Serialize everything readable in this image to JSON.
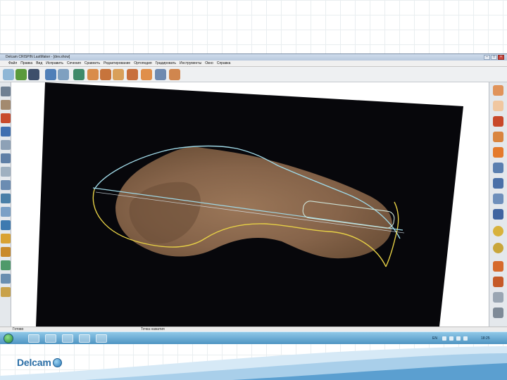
{
  "window": {
    "title": "Delcam CRISPIN LastMaker - [dev.show]",
    "controls": {
      "minimize": "–",
      "maximize": "□",
      "close": "×"
    }
  },
  "menu": {
    "items": [
      "Файл",
      "Правка",
      "Вид",
      "Исправить",
      "Сечения",
      "Сравнить",
      "Редактирование",
      "Ортопедия",
      "Градировать",
      "Инструменты",
      "Окно",
      "Справка"
    ]
  },
  "status_bar": {
    "left": "Готово",
    "middle": "Точка нажатия"
  },
  "taskbar": {
    "language": "EN",
    "clock": "18:25"
  },
  "logo": {
    "text": "Delcam"
  },
  "colors": {
    "foot_skin": "#86644a",
    "outline_cyan": "#9fd8e6",
    "outline_yellow": "#e6d046",
    "accent": "#2a6ea6"
  },
  "icons": {
    "toolbar": [
      "new-file-icon",
      "open-folder-icon",
      "save-icon",
      "undo-icon",
      "redo-icon",
      "last-view-icon",
      "insole-icon",
      "sole-icon",
      "heel-icon",
      "shoe-icon",
      "shoe-cut-icon",
      "shoe-grade-icon",
      "shoe-fit-icon"
    ],
    "left": [
      "section-icon",
      "shoe-profile-icon",
      "heel-height-icon",
      "last-bottom-icon",
      "align-icon",
      "rotate-icon",
      "measure-icon",
      "point-icon",
      "grid-icon",
      "cut-icon",
      "marker-icon",
      "insole-tool-icon",
      "layer-icon",
      "edit-tool-icon",
      "shoe-tool-icon",
      "pad-icon"
    ],
    "right": [
      "insole-view-icon",
      "toe-view-icon",
      "orange-cone-icon",
      "foot-view-icon",
      "orange-shoe-icon",
      "zoom-in-icon",
      "zoom-out-icon",
      "zoom-fit-icon",
      "pan-icon",
      "sphere-icon",
      "globe-icon",
      "orange-sole-icon",
      "orange-heel-icon",
      "hatch-icon",
      "render-icon"
    ]
  }
}
